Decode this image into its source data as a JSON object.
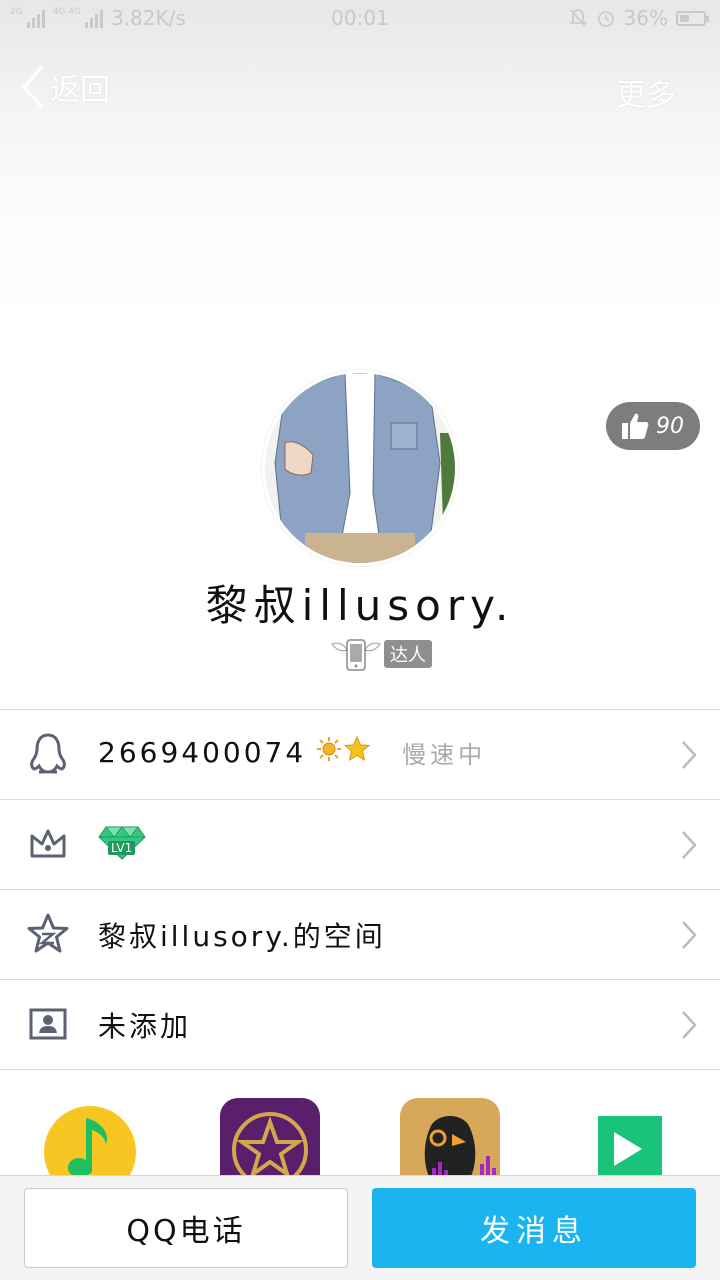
{
  "status_bar": {
    "network_speed": "3.82K/s",
    "time": "00:01",
    "battery_percent": "36%",
    "sim1_tag": "2G",
    "sim2_tag": "4G 4G",
    "icons": [
      "signal-icon",
      "mute-bell-icon",
      "alarm-icon",
      "battery-icon"
    ]
  },
  "nav": {
    "back_label": "返回",
    "more_label": "更多"
  },
  "profile": {
    "like_count": "90",
    "nickname": "黎叔illusory.",
    "badge_label": "达人"
  },
  "rows": [
    {
      "id": "qq-number",
      "icon": "penguin-icon",
      "text": "2669400074",
      "status": "慢速中",
      "level_icons": [
        "sun-icon",
        "star-icon"
      ]
    },
    {
      "id": "vip-level",
      "icon": "crown-icon",
      "text": "",
      "level_label": "LV1"
    },
    {
      "id": "qzone",
      "icon": "qzone-star-icon",
      "text": "黎叔illusory.的空间"
    },
    {
      "id": "contact-card",
      "icon": "contact-card-icon",
      "text": "未添加"
    }
  ],
  "apps": [
    {
      "name": "qq-music-icon",
      "color": "#f7c623"
    },
    {
      "name": "star-app-icon",
      "color": "#5a1f6b"
    },
    {
      "name": "penguin-app-icon",
      "color": "#d7a85a"
    },
    {
      "name": "video-app-icon",
      "color": "#19c47a"
    }
  ],
  "actions": {
    "call_label": "QQ电话",
    "message_label": "发消息"
  },
  "colors": {
    "accent": "#1ab4f0",
    "divider": "#dcdcdc",
    "like_pill": "#7d7d7d"
  }
}
